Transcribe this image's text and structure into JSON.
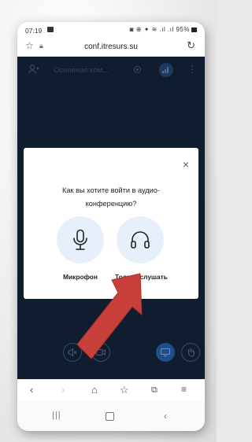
{
  "status_bar": {
    "time": "07:19",
    "indicators": "◙ ⊕ ✦ ≋ .ıl .ıl",
    "battery": "95%"
  },
  "browser": {
    "url": "conf.itresurs.su"
  },
  "conference": {
    "room_name": "Основная ком..."
  },
  "dialog": {
    "question": "Как вы хотите войти в аудио-конференцию?",
    "close_symbol": "×",
    "options": [
      {
        "label": "Микрофон",
        "icon": "microphone-icon"
      },
      {
        "label": "Только слушать",
        "icon": "headphones-icon"
      }
    ]
  },
  "annotation": {
    "arrow_color": "#c8403a"
  },
  "colors": {
    "conference_bg": "#0f1d2e",
    "option_circle": "#e7f0fa",
    "accent": "#1f4f8a"
  }
}
